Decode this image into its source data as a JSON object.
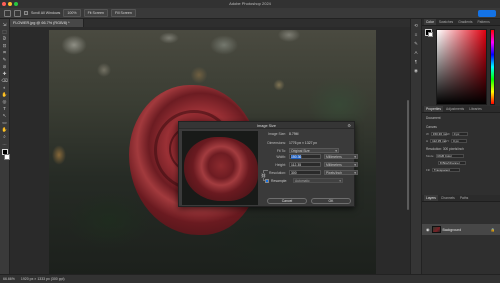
{
  "window": {
    "title": "Adobe Photoshop 2024",
    "traffic_colors": [
      "#ff5f57",
      "#febc2e",
      "#28c840"
    ]
  },
  "options_bar": {
    "scroll_all_windows": "Scroll All Windows",
    "zoom_100": "100%",
    "fit_screen": "Fit Screen",
    "fill_screen": "Fill Screen"
  },
  "document": {
    "tab_label": "FLOWER.jpg @ 66.7% (RGB/8) *",
    "zoom": "66.66%",
    "status": "1920 px × 1333 px (300 ppi)"
  },
  "toolbar": {
    "tools": [
      "⇲",
      "⬚",
      "ᘐ",
      "⊡",
      "⌗",
      "✎",
      "⊘",
      "✚",
      "⌫",
      "◐",
      "✋",
      "◎",
      "T",
      "↖",
      "▭",
      "✋",
      "⌕",
      "…"
    ]
  },
  "dialog": {
    "title": "Image Size",
    "image_size_label": "Image Size:",
    "image_size_value": "8.79M",
    "dimensions_label": "Dimensions:",
    "dimensions_value": "1776 px × 1327 px",
    "fit_to_label": "Fit To:",
    "fit_to_value": "Original Size",
    "width_label": "Width:",
    "width_value": "150.36",
    "width_unit": "Millimeters",
    "height_label": "Height:",
    "height_value": "112.35",
    "height_unit": "Millimeters",
    "resolution_label": "Resolution:",
    "resolution_value": "300",
    "resolution_unit": "Pixels/Inch",
    "resample_label": "Resample:",
    "resample_value": "Automatic",
    "cancel_label": "Cancel",
    "ok_label": "OK"
  },
  "panels": {
    "color_tabs": [
      "Color",
      "Swatches",
      "Gradients",
      "Patterns"
    ],
    "properties_tabs": [
      "Properties",
      "Adjustments",
      "Libraries"
    ],
    "properties": {
      "document_label": "Document",
      "canvas_label": "Canvas",
      "w_label": "W",
      "w_value": "150.36 mm",
      "h_label": "H",
      "h_value": "112.35 mm",
      "x_label": "X",
      "x_value": "0 px",
      "y_label": "Y",
      "y_value": "0 px",
      "resolution_label": "Resolution: 300 pixels/inch",
      "mode_label": "Mode",
      "mode_value": "RGB Color",
      "bits_value": "8 Bits/Channel",
      "fill_label": "Fill",
      "fill_value": "Transparent"
    },
    "layers_tabs": [
      "Layers",
      "Channels",
      "Paths"
    ],
    "layer_name": "Background"
  },
  "colors": {
    "accent": "#1473e6",
    "panel_bg": "#2f2f2f",
    "dialog_bg": "#3a3a3a"
  }
}
